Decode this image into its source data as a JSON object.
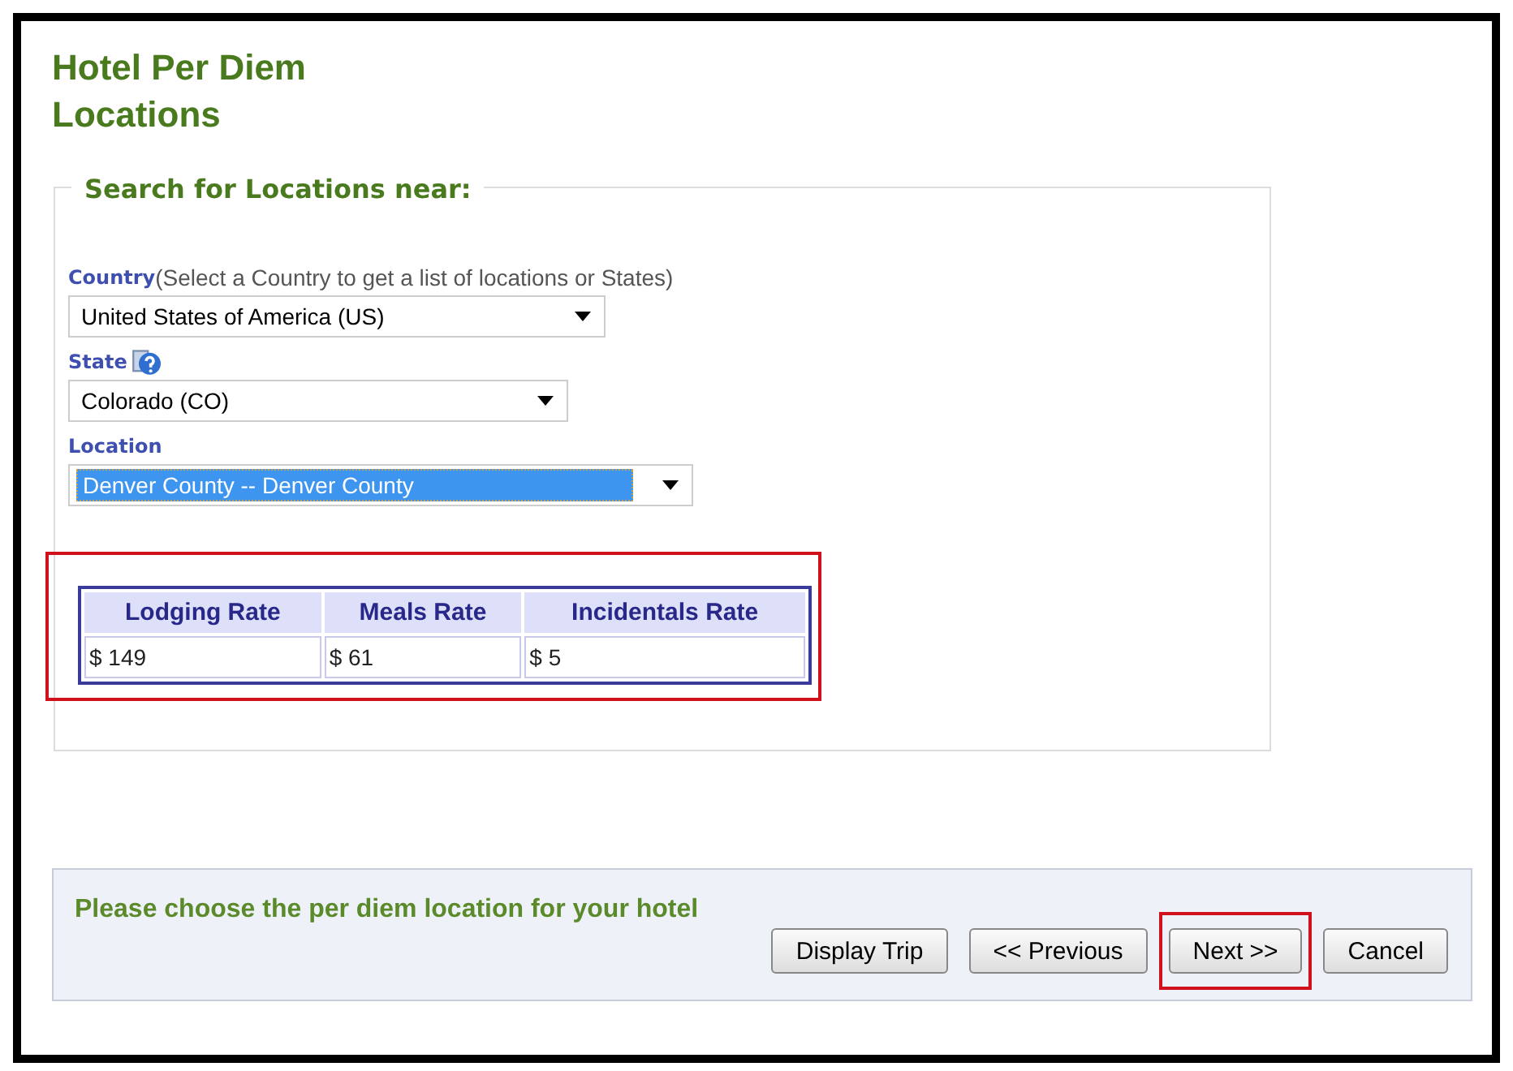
{
  "page": {
    "title": "Hotel Per Diem Locations"
  },
  "search": {
    "legend": "Search for Locations near:",
    "fields": [
      {
        "label": "Country",
        "hint": "(Select a Country to get a list of locations or States)",
        "value": "United States of America (US)",
        "help": false,
        "focused": false
      },
      {
        "label": "State",
        "value": "Colorado (CO)",
        "help": true,
        "focused": false
      },
      {
        "label": "Location",
        "value": "Denver County -- Denver County",
        "help": false,
        "focused": true
      }
    ]
  },
  "rates": {
    "highlighted": true,
    "columns": [
      "Lodging Rate",
      "Meals Rate",
      "Incidentals Rate"
    ],
    "rows": [
      [
        "$ 149",
        "$ 61",
        "$ 5"
      ]
    ]
  },
  "footer": {
    "message": "Please choose the per diem location for your hotel",
    "buttons": [
      {
        "label": "Display Trip",
        "highlighted": false
      },
      {
        "label": "<< Previous",
        "highlighted": false
      },
      {
        "label": "Next >>",
        "highlighted": true
      },
      {
        "label": "Cancel",
        "highlighted": false
      }
    ]
  }
}
